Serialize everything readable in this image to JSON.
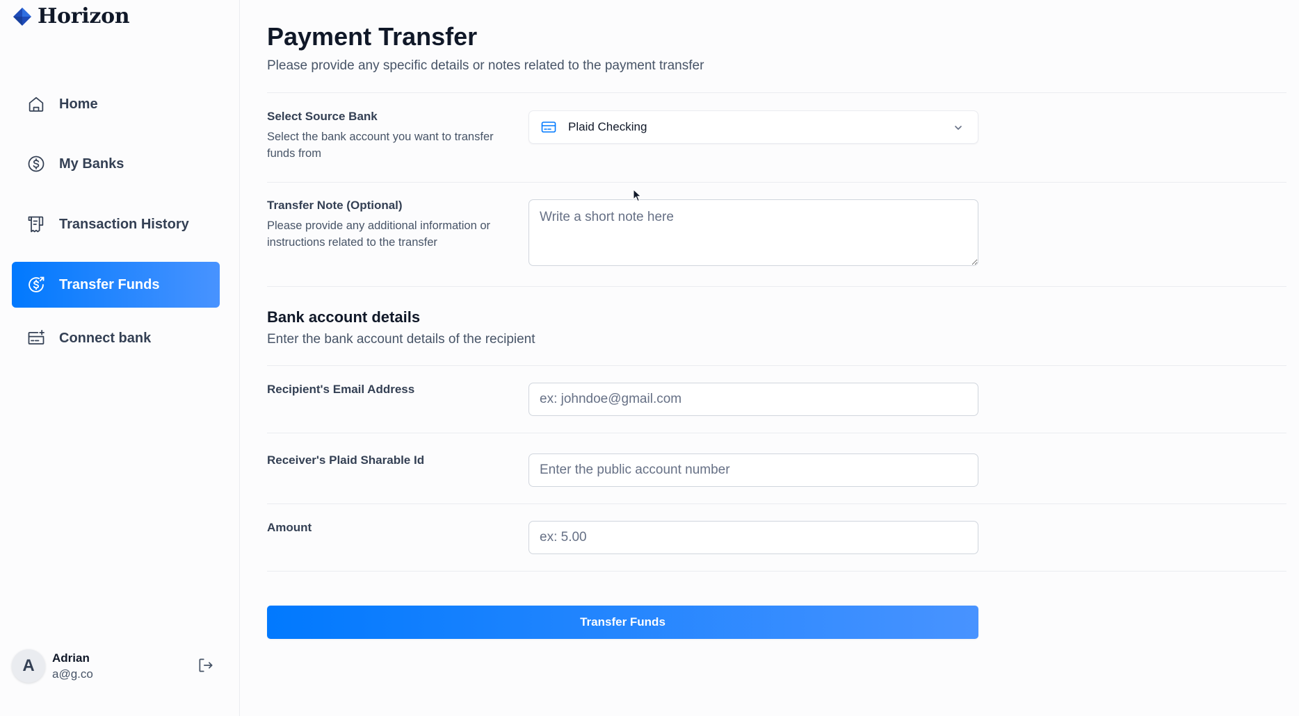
{
  "app": {
    "name": "Horizon"
  },
  "sidebar": {
    "items": [
      {
        "label": "Home",
        "icon": "home-icon",
        "active": false
      },
      {
        "label": "My Banks",
        "icon": "dollar-circle-icon",
        "active": false
      },
      {
        "label": "Transaction History",
        "icon": "receipt-icon",
        "active": false
      },
      {
        "label": "Transfer Funds",
        "icon": "money-send-icon",
        "active": true
      },
      {
        "label": "Connect bank",
        "icon": "card-add-icon",
        "active": false
      }
    ],
    "user": {
      "initial": "A",
      "name": "Adrian",
      "email": "a@g.co"
    }
  },
  "page": {
    "title": "Payment Transfer",
    "subtitle": "Please provide any specific details or notes related to the payment transfer"
  },
  "form": {
    "source_bank": {
      "label": "Select Source Bank",
      "description": "Select the bank account you want to transfer funds from",
      "selected": "Plaid Checking"
    },
    "note": {
      "label": "Transfer Note (Optional)",
      "description": "Please provide any additional information or instructions related to the transfer",
      "placeholder": "Write a short note here",
      "value": ""
    },
    "bank_details": {
      "title": "Bank account details",
      "subtitle": "Enter the bank account details of the recipient"
    },
    "email": {
      "label": "Recipient's Email Address",
      "placeholder": "ex: johndoe@gmail.com",
      "value": ""
    },
    "sharable_id": {
      "label": "Receiver's Plaid Sharable Id",
      "placeholder": "Enter the public account number",
      "value": ""
    },
    "amount": {
      "label": "Amount",
      "placeholder": "ex: 5.00",
      "value": ""
    },
    "submit_label": "Transfer Funds"
  },
  "colors": {
    "accent": "#0179fe",
    "accent_light": "#4893ff",
    "text_primary": "#101828",
    "text_secondary": "#475467",
    "border": "#d0d5dd"
  }
}
